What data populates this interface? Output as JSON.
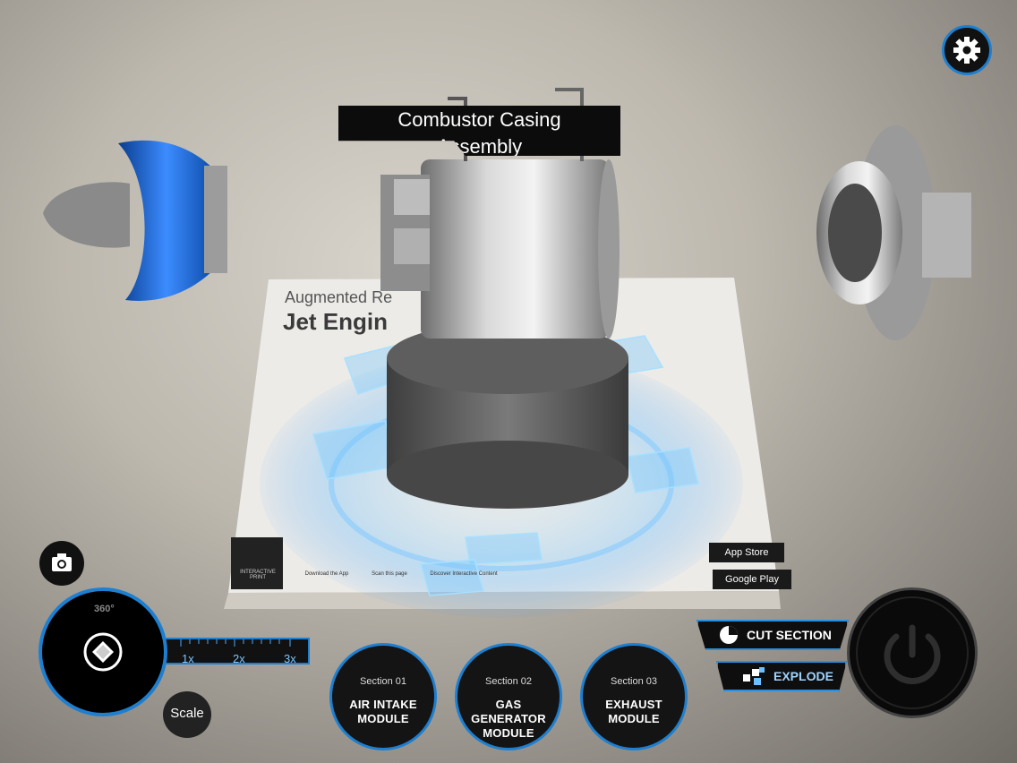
{
  "banner": {
    "line1": "Combustor Casing",
    "line2": "Assembly"
  },
  "sections": [
    {
      "num": "Section 01",
      "name1": "AIR INTAKE",
      "name2": "MODULE"
    },
    {
      "num": "Section 02",
      "name1": "GAS GENERATOR",
      "name2": "MODULE"
    },
    {
      "num": "Section 03",
      "name1": "EXHAUST",
      "name2": "MODULE"
    }
  ],
  "actions": {
    "cut_section": "CUT SECTION",
    "explode": "EXPLODE"
  },
  "scale": {
    "label": "Scale",
    "ticks": [
      "1x",
      "2x",
      "3x"
    ],
    "current": 1
  },
  "rotate": {
    "badge": "360°"
  },
  "print": {
    "title1": "Augmented Re",
    "title2": "Jet Engin",
    "steps": [
      "INTERACTIVE PRINT",
      "Download the App",
      "Scan this page",
      "Discover Interactive Content"
    ],
    "stores": [
      "App Store",
      "Google Play"
    ]
  },
  "colors": {
    "accent": "#1e7fd0",
    "engine_blue": "#1a5fc8",
    "panel": "#111111"
  },
  "icons": [
    "gear-icon",
    "camera-icon",
    "joystick-icon",
    "power-icon",
    "pie-chart-icon",
    "explode-cubes-icon"
  ]
}
